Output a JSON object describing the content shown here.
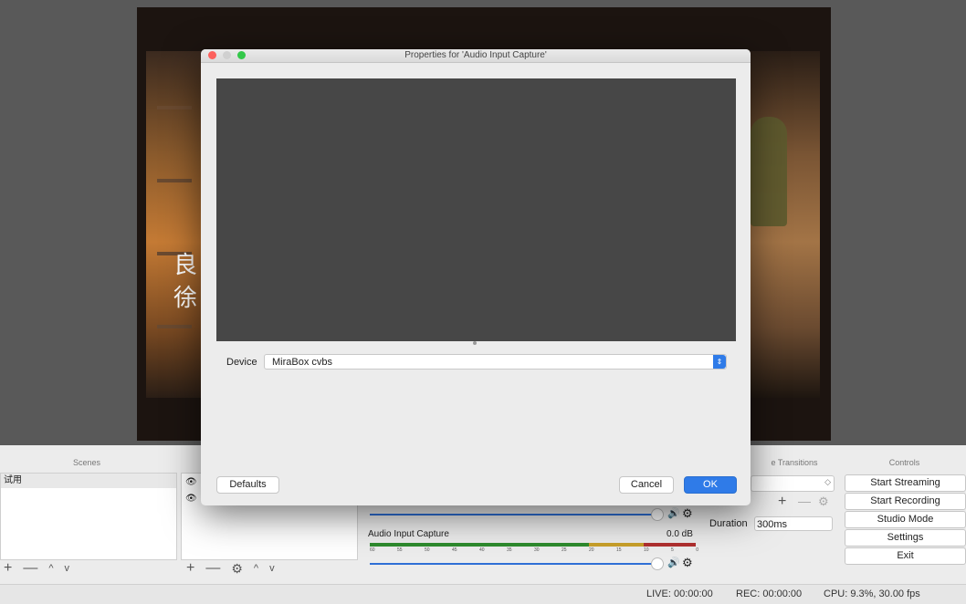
{
  "dialog": {
    "title": "Properties for 'Audio Input Capture'",
    "device_label": "Device",
    "device_value": "MiraBox cvbs",
    "defaults_label": "Defaults",
    "cancel_label": "Cancel",
    "ok_label": "OK"
  },
  "preview": {
    "caption_line1": "良",
    "caption_line2": "徐"
  },
  "docks": {
    "scenes_header": "Scenes",
    "transitions_header": "e Transitions",
    "controls_header": "Controls"
  },
  "scenes": {
    "items": [
      "试用"
    ]
  },
  "mixer": {
    "track_name": "Audio Input Capture",
    "track_level": "0.0 dB",
    "scale_ticks": [
      "60",
      "55",
      "50",
      "45",
      "40",
      "35",
      "30",
      "25",
      "20",
      "15",
      "10",
      "5",
      "0"
    ]
  },
  "transitions": {
    "duration_label": "Duration",
    "duration_value": "300ms"
  },
  "controls": {
    "start_streaming": "Start Streaming",
    "start_recording": "Start Recording",
    "studio_mode": "Studio Mode",
    "settings": "Settings",
    "exit": "Exit"
  },
  "status": {
    "live": "LIVE: 00:00:00",
    "rec": "REC: 00:00:00",
    "cpu": "CPU: 9.3%, 30.00 fps"
  },
  "toolbar_glyphs": {
    "add": "+",
    "remove": "—",
    "up": "^",
    "down": "v",
    "gear": "⚙",
    "speaker": "🔊"
  },
  "colors": {
    "accent": "#2f7be8",
    "meter_green": "#2e8b2e",
    "meter_yellow": "#c8a02a",
    "meter_red": "#b03030"
  }
}
